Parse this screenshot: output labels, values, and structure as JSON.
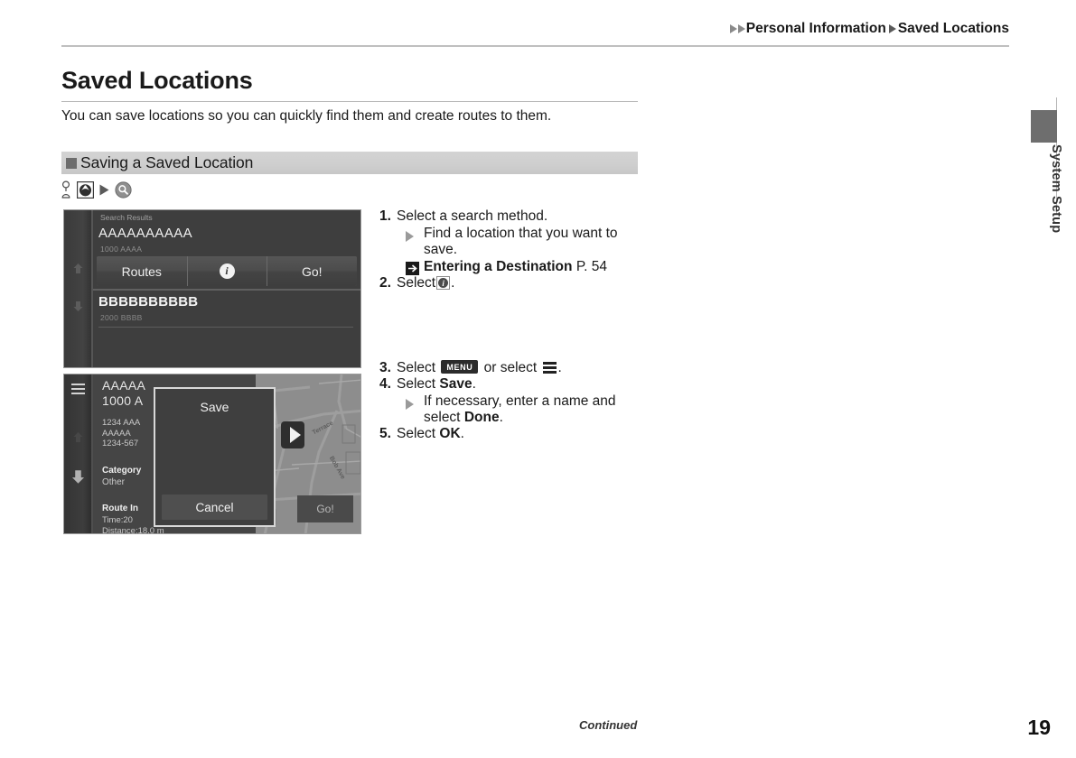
{
  "breadcrumb": {
    "parent": "Personal Information",
    "current": "Saved Locations"
  },
  "side_tab": {
    "label": "System Setup"
  },
  "page": {
    "title": "Saved Locations",
    "intro": "You can save locations so you can quickly find them and create routes to them.",
    "section_title": "Saving a Saved Location",
    "footer_continued": "Continued",
    "page_number": "19"
  },
  "nav_path_icons": [
    {
      "name": "pin-icon"
    },
    {
      "name": "home-boxed-icon"
    },
    {
      "name": "arrow-right-icon"
    },
    {
      "name": "search-circle-icon"
    }
  ],
  "screenshot_search_results": {
    "header": "Search Results",
    "result1_name": "AAAAAAAAAA",
    "result1_address": "1000 AAAA",
    "buttons": {
      "routes": "Routes",
      "info": "i",
      "go": "Go!"
    },
    "result2_name": "BBBBBBBBBB",
    "result2_address": "2000 BBBB"
  },
  "screenshot_save_dialog": {
    "place_name": "AAAAA",
    "place_number": "1000 A",
    "address_line1": "1234 AAA",
    "address_line2": "AAAAA",
    "address_line3": "1234-567",
    "category_label": "Category",
    "category_value": "Other",
    "route_label": "Route In",
    "route_time": "Time:20",
    "route_distance": "Distance:18.0 m",
    "dialog_title": "Save",
    "dialog_cancel": "Cancel",
    "map_go": "Go!",
    "map_street1": "Terrace",
    "map_street2": "Bob Ave"
  },
  "steps": {
    "s1_num": "1.",
    "s1_text": "Select a search method.",
    "s1_sub": "Find a location that you want to save.",
    "s1_ref_title": "Entering a Destination",
    "s1_ref_page": "P. 54",
    "s2_num": "2.",
    "s2_text_before": "Select",
    "s2_text_after": ".",
    "s3_num": "3.",
    "s3_text_before": "Select",
    "s3_key": "MENU",
    "s3_text_mid": "or select",
    "s3_text_after": ".",
    "s4_num": "4.",
    "s4_text_before": "Select",
    "s4_bold": "Save",
    "s4_text_after": ".",
    "s4_sub_before": "If necessary, enter a name and select",
    "s4_sub_bold": "Done",
    "s4_sub_after": ".",
    "s5_num": "5.",
    "s5_text_before": "Select",
    "s5_bold": "OK",
    "s5_text_after": "."
  },
  "colors": {
    "section_bar": "#cfcfcf",
    "rule": "#bfbfbf",
    "device_dark": "#3e3e3e",
    "map_gray": "#8d8d8d"
  }
}
